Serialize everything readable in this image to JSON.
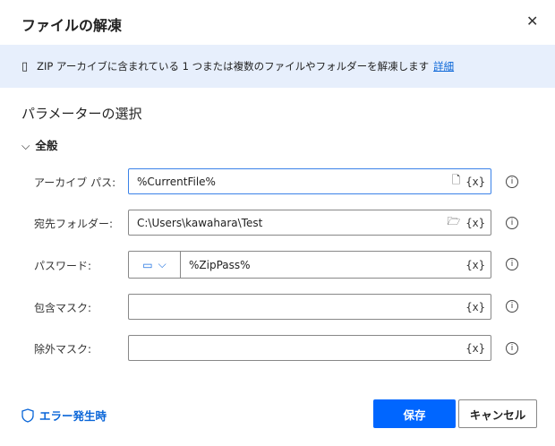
{
  "title": "ファイルの解凍",
  "banner": {
    "text": "ZIP アーカイブに含まれている 1 つまたは複数のファイルやフォルダーを解凍します",
    "link": "詳細"
  },
  "section": "パラメーターの選択",
  "group": "全般",
  "fields": [
    {
      "label": "アーカイブ パス:",
      "value": "%CurrentFile%"
    },
    {
      "label": "宛先フォルダー:",
      "value": "C:\\Users\\kawahara\\Test"
    },
    {
      "label": "パスワード:",
      "value": "%ZipPass%"
    },
    {
      "label": "包含マスク:",
      "value": ""
    },
    {
      "label": "除外マスク:",
      "value": ""
    }
  ],
  "var_label": "{x}",
  "info": "i",
  "footer": {
    "on_error": "エラー発生時",
    "save": "保存",
    "cancel": "キャンセル"
  }
}
